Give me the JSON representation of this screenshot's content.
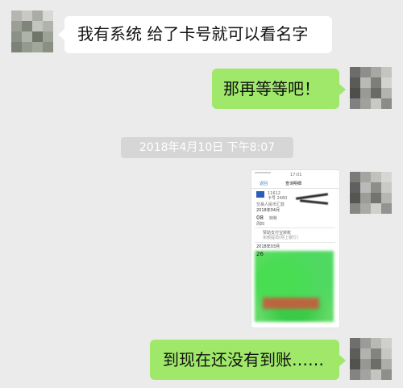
{
  "messages": [
    {
      "side": "left",
      "text": "我有系统  给了卡号就可以看名字"
    },
    {
      "side": "right",
      "text": "那再等等吧！"
    },
    {
      "side": "right",
      "text": "到现在还没有到账……"
    }
  ],
  "timestamp": "2018年4月10日 下午8:07",
  "screenshot_message": {
    "status_time": "17:01",
    "back_label": "返回",
    "nav_title": "查询明细",
    "card_line": "11612",
    "card_sub": "卡号 2460",
    "bank_label": "交易人民币汇款",
    "month_1": "2018年04月",
    "day_1": "08",
    "day_1_week": "周四",
    "day_1_desc": "转账",
    "entry_2": "赞助支付宝转账",
    "entry_2_sub": "余额提现(网上银行)",
    "month_2": "2018年03月",
    "day_2": "26"
  },
  "colors": {
    "background": "#ebebeb",
    "bubble_left": "#ffffff",
    "bubble_right": "#9fe86a",
    "timestamp_bg": "#d6d6d6"
  }
}
